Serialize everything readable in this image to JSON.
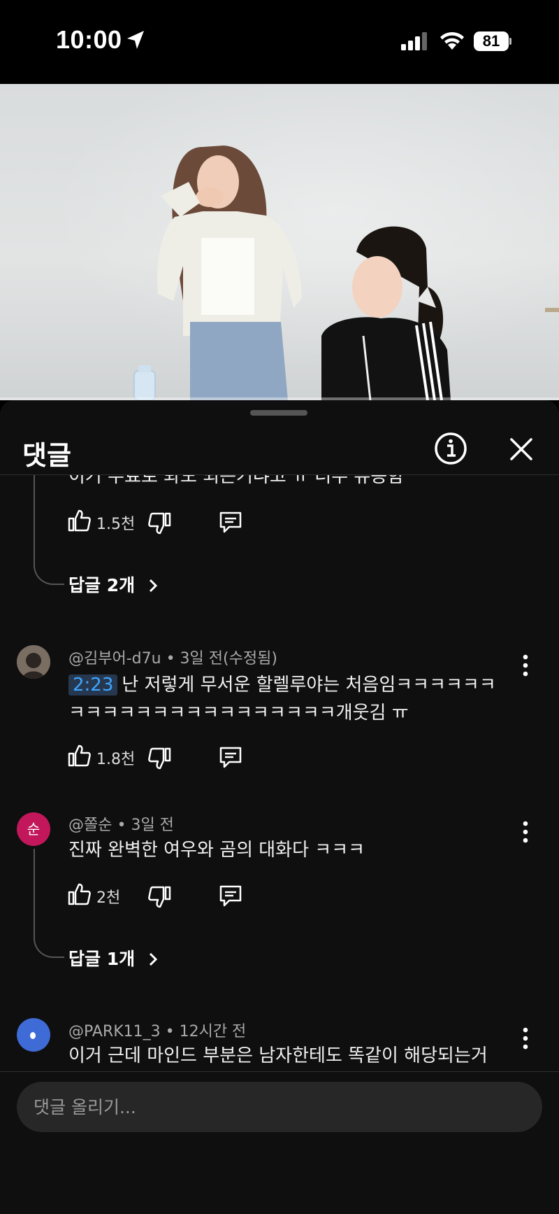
{
  "status_bar": {
    "time": "10:00",
    "battery": "81",
    "icons": [
      "location-arrow-icon",
      "signal-icon",
      "wifi-icon",
      "battery-icon"
    ]
  },
  "video": {
    "description_icon": "video-frame",
    "progress": 1.0
  },
  "comments_panel": {
    "title": "댓글",
    "info_icon": "info-icon",
    "close_icon": "close-icon"
  },
  "comments": [
    {
      "text_partial": "이거 무료로 봐도 되는거냐고 ㅠ 너무 유용함",
      "likes": "1.5천",
      "replies": "답글 2개"
    },
    {
      "author": "@김부어-d7u",
      "meta": " • 3일 전(수정됨)",
      "timestamp_link": "2:23",
      "line1": "난 저렇게 무서운 할렐루야는 처음임ㅋㅋㅋㅋㅋㅋ",
      "line2": "ㅋㅋㅋㅋㅋㅋㅋㅋㅋㅋㅋㅋㅋㅋㅋㅋ개웃김 ㅠ",
      "likes": "1.8천"
    },
    {
      "author": "@쫄순",
      "meta": " • 3일 전",
      "avatar_letter": "순",
      "text": "진짜 완벽한 여우와 곰의 대화다 ㅋㅋㅋ",
      "likes": "2천",
      "replies": "답글 1개"
    },
    {
      "author": "@PARK11_3",
      "meta": " • 12시간 전",
      "text": "이거 근데 마인드 부분은 남자한테도 똑같이 해당되는거"
    }
  ],
  "input": {
    "placeholder": "댓글 올리기..."
  },
  "colors": {
    "background": "#0f0f0f",
    "link_blue": "#3ea6ff",
    "avatar_pink": "#c2185b",
    "avatar_blue": "#3f6bd6"
  }
}
